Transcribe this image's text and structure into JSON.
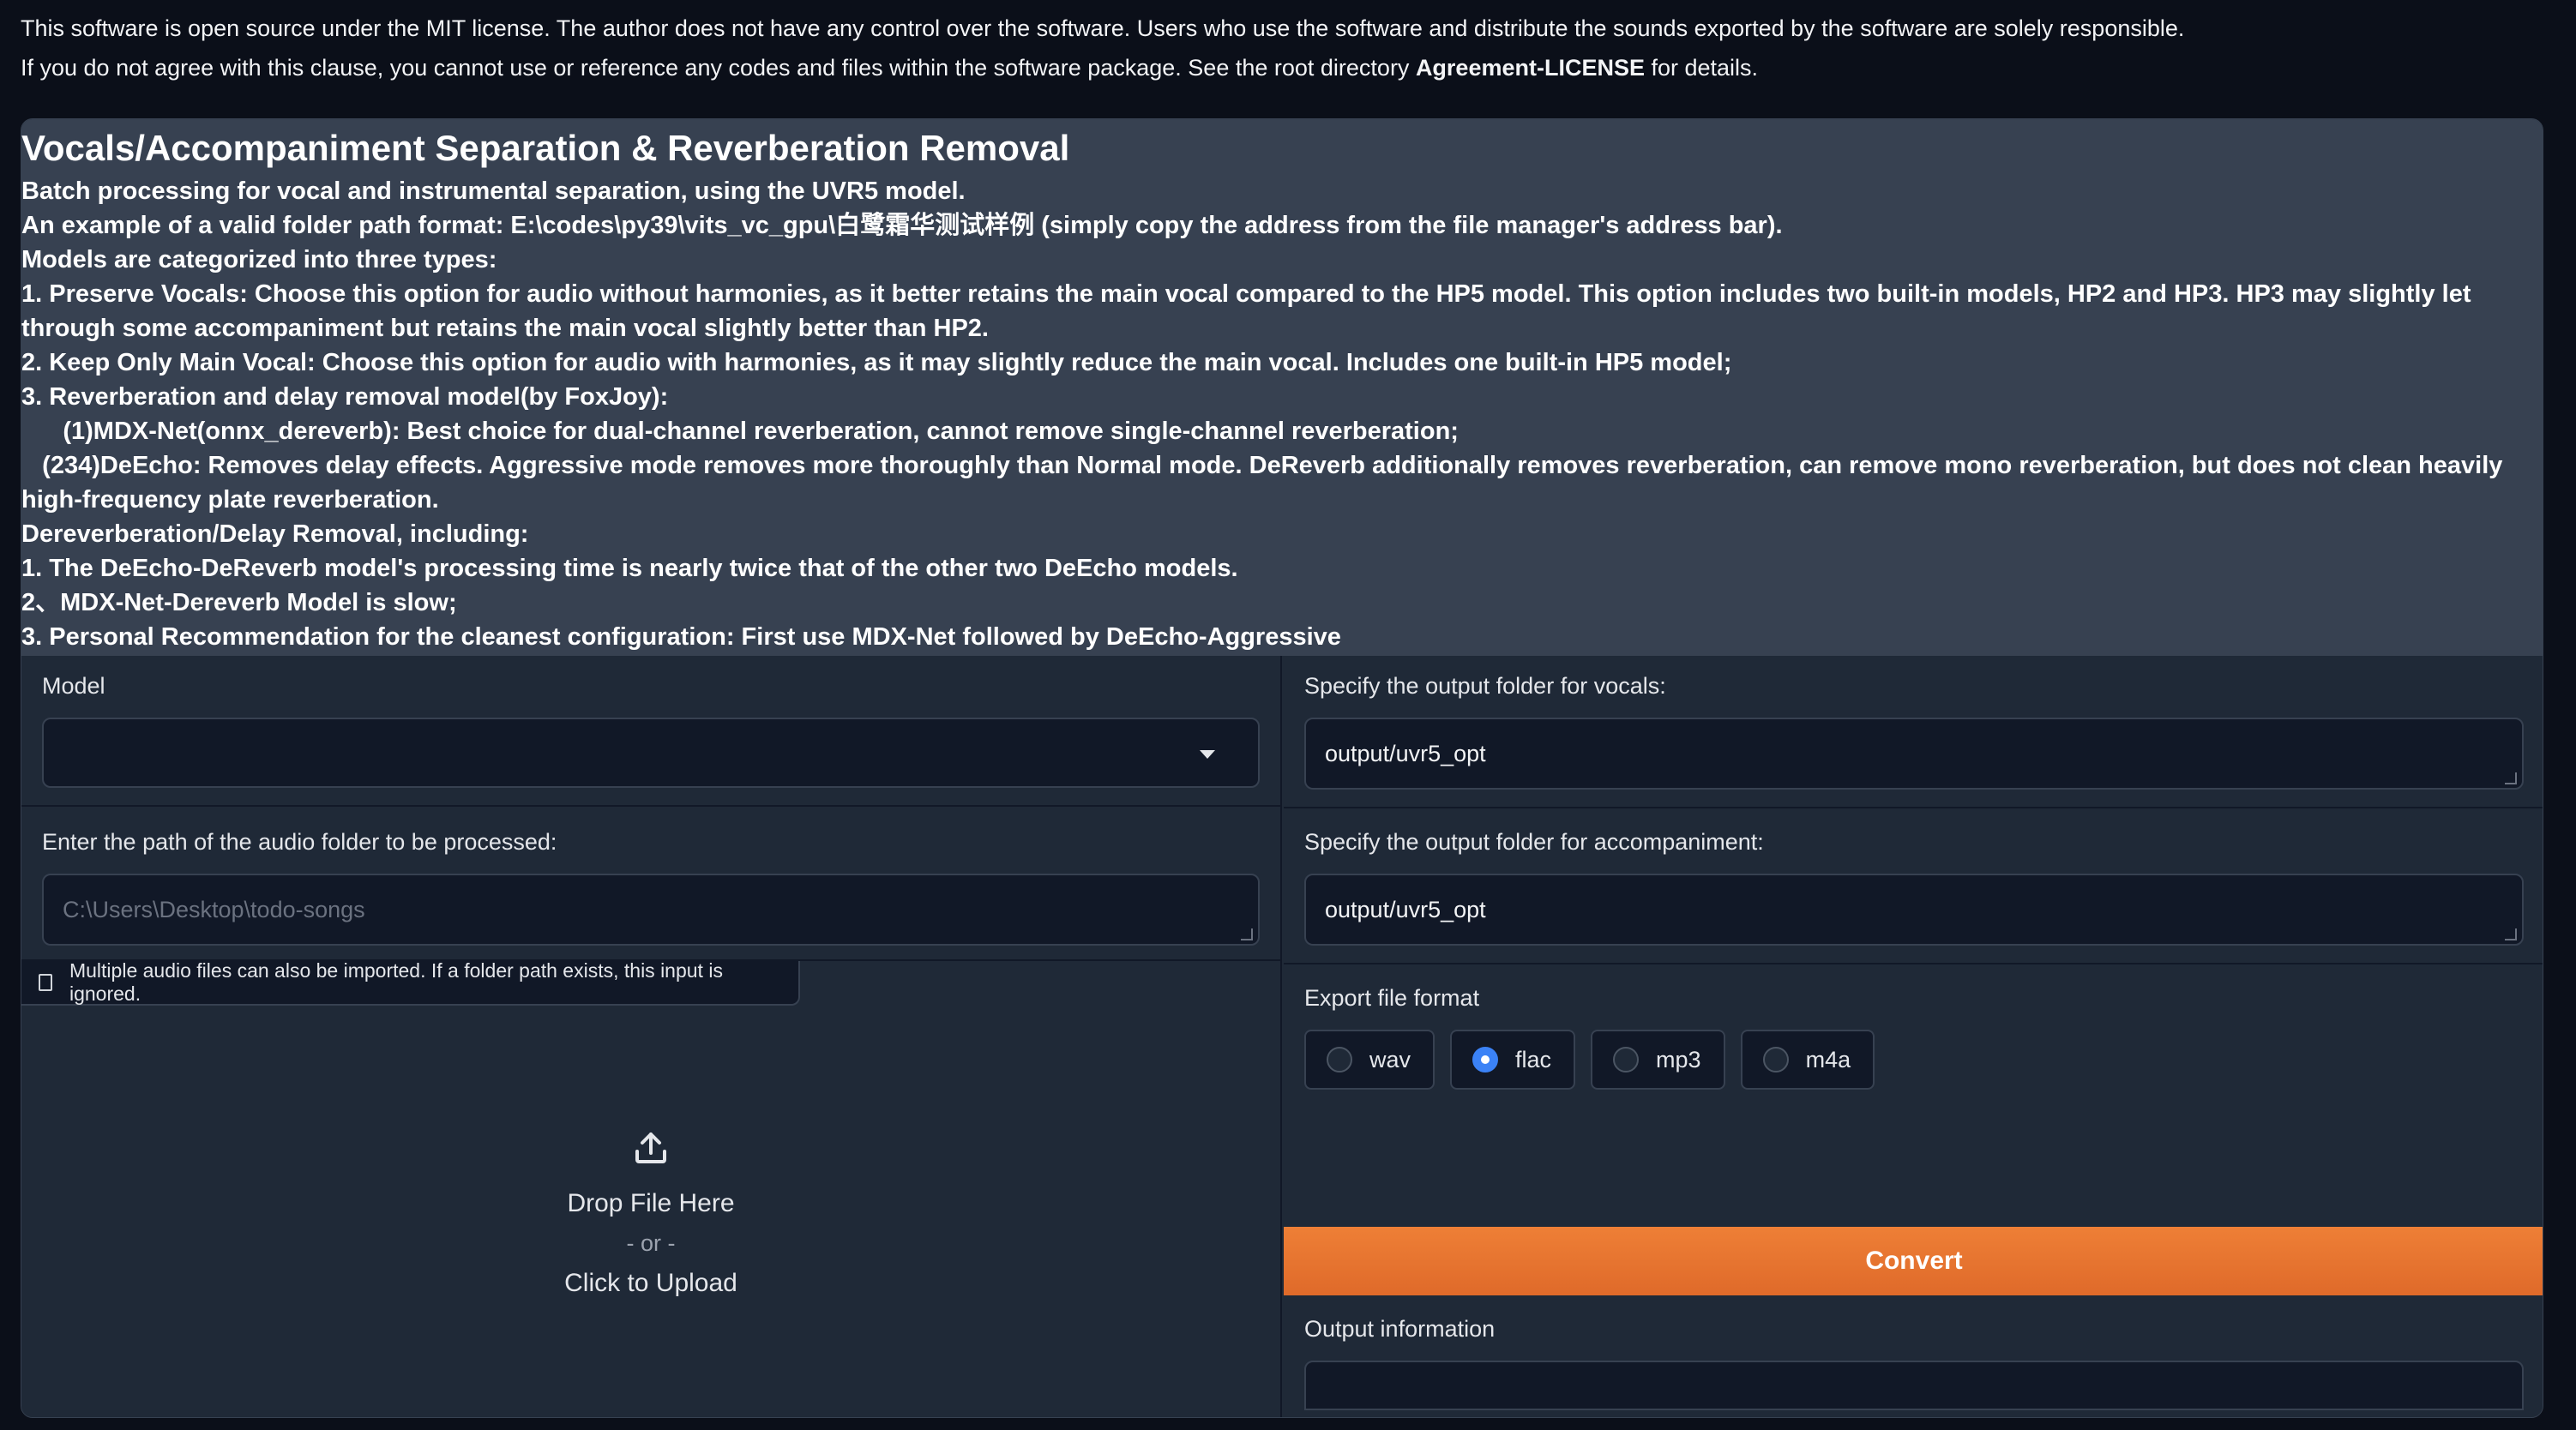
{
  "license": {
    "line1": "This software is open source under the MIT license. The author does not have any control over the software. Users who use the software and distribute the sounds exported by the software are solely responsible.",
    "line2_pre": "If you do not agree with this clause, you cannot use or reference any codes and files within the software package. See the root directory ",
    "line2_bold": "Agreement-LICENSE",
    "line2_post": " for details."
  },
  "description": {
    "title": "Vocals/Accompaniment Separation & Reverberation Removal",
    "lines": [
      "Batch processing for vocal and instrumental separation, using the UVR5 model.",
      "An example of a valid folder path format: E:\\codes\\py39\\vits_vc_gpu\\白鹭霜华测试样例 (simply copy the address from the file manager's address bar).",
      "Models are categorized into three types:",
      "1. Preserve Vocals: Choose this option for audio without harmonies, as it better retains the main vocal compared to the HP5 model. This option includes two built-in models, HP2 and HP3. HP3 may slightly let through some accompaniment but retains the main vocal slightly better than HP2.",
      "2. Keep Only Main Vocal: Choose this option for audio with harmonies, as it may slightly reduce the main vocal. Includes one built-in HP5 model;",
      "3. Reverberation and delay removal model(by FoxJoy):",
      "      (1)MDX-Net(onnx_dereverb): Best choice for dual-channel reverberation, cannot remove single-channel reverberation;",
      "   (234)DeEcho: Removes delay effects. Aggressive mode removes more thoroughly than Normal mode. DeReverb additionally removes reverberation, can remove mono reverberation, but does not clean heavily high-frequency plate reverberation.",
      "Dereverberation/Delay Removal, including:",
      "1. The DeEcho-DeReverb model's processing time is nearly twice that of the other two DeEcho models.",
      "2、MDX-Net-Dereverb Model is slow;",
      "3. Personal Recommendation for the cleanest configuration: First use MDX-Net followed by DeEcho-Aggressive"
    ]
  },
  "left": {
    "model_label": "Model",
    "model_value": "",
    "path_label": "Enter the path of the audio folder to be processed:",
    "path_placeholder": "C:\\Users\\Desktop\\todo-songs",
    "upload_hint": "Multiple audio files can also be imported. If a folder path exists, this input is ignored.",
    "drop_text": "Drop File Here",
    "or_text": "- or -",
    "click_text": "Click to Upload"
  },
  "right": {
    "vocals_label": "Specify the output folder for vocals:",
    "vocals_value": "output/uvr5_opt",
    "accomp_label": "Specify the output folder for accompaniment:",
    "accomp_value": "output/uvr5_opt",
    "format_label": "Export file format",
    "formats": [
      "wav",
      "flac",
      "mp3",
      "m4a"
    ],
    "selected_format": "flac",
    "convert_label": "Convert",
    "output_label": "Output information",
    "output_value": ""
  },
  "colors": {
    "accent": "#e8742f",
    "radio_selected": "#3b82f6",
    "background": "#0b0f19",
    "panel": "#1f2937"
  }
}
